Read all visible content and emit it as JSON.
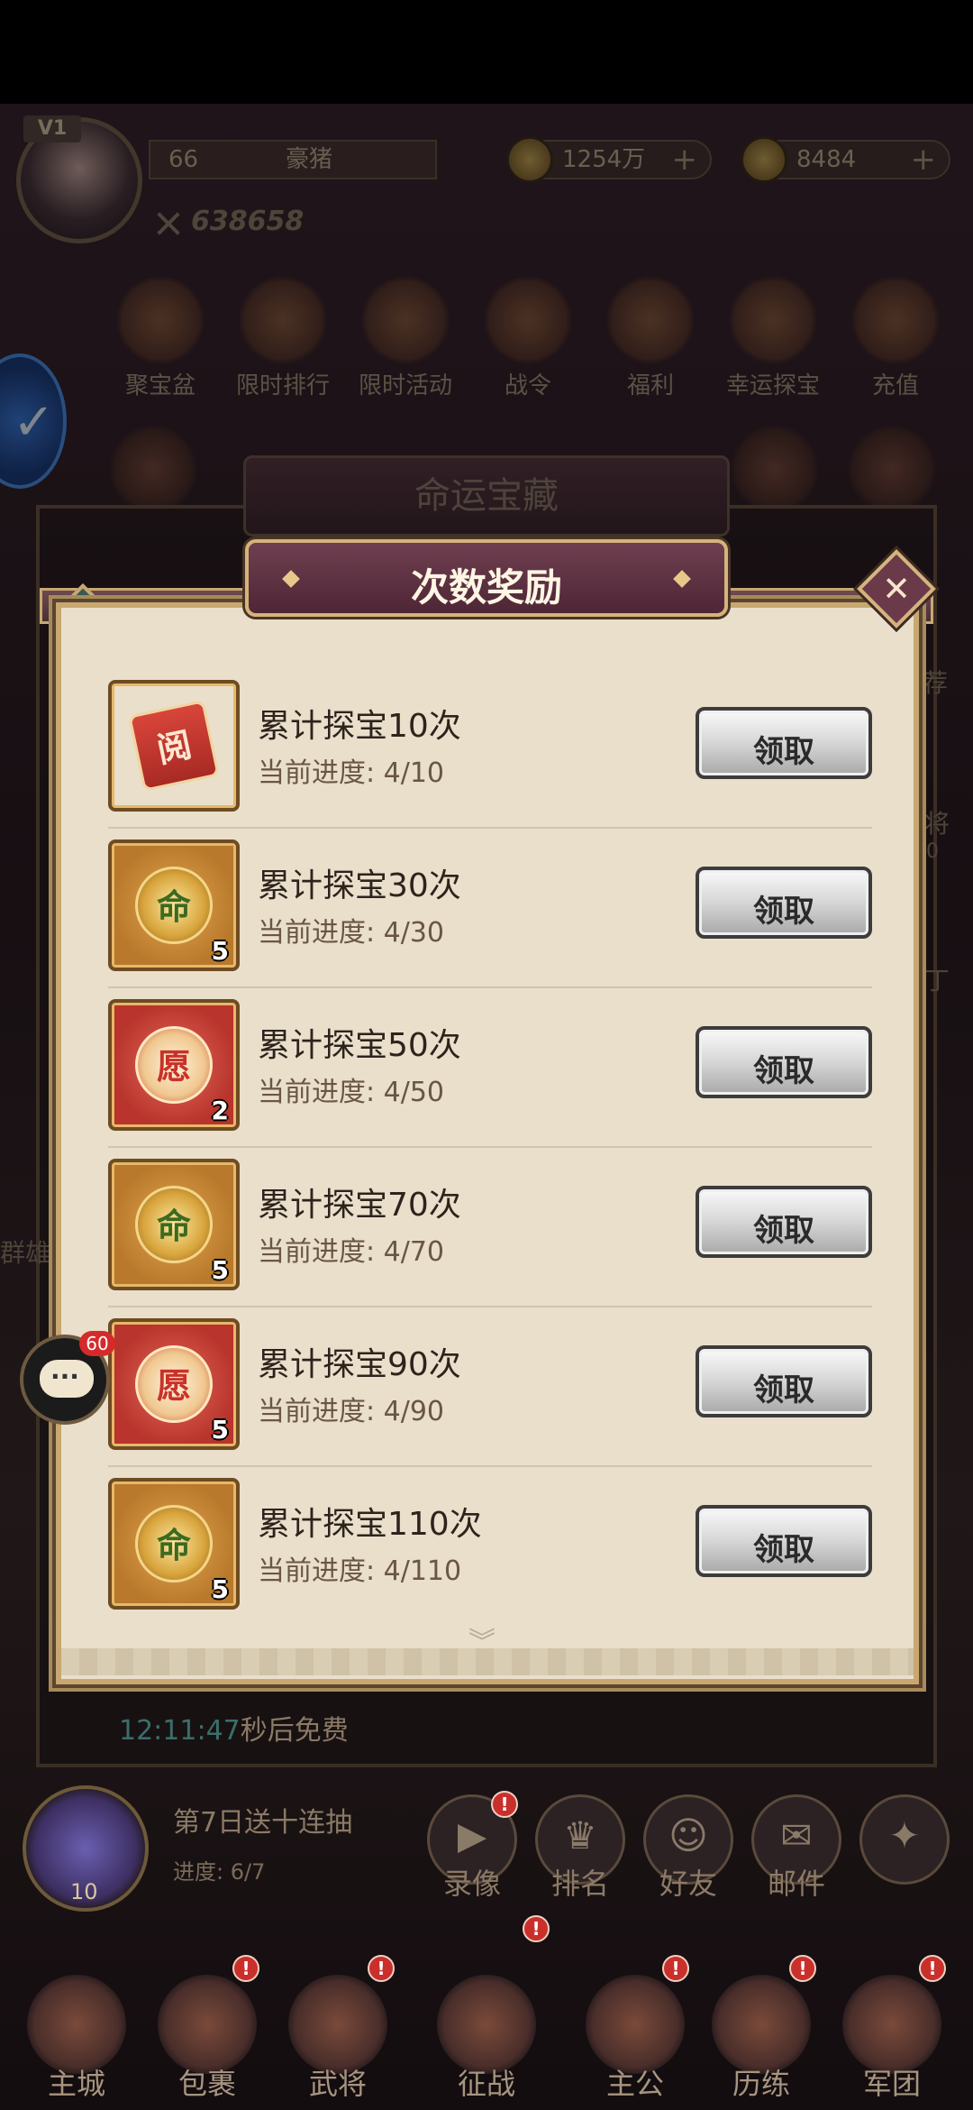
{
  "player": {
    "vip": "V1",
    "level": "66",
    "name": "豪猪",
    "power": "638658"
  },
  "currency": {
    "coins": "1254万",
    "ingots": "8484"
  },
  "top_menu": [
    {
      "label": "聚宝盆",
      "icon": "treasure-bowl-icon"
    },
    {
      "label": "限时排行",
      "icon": "trophy-icon"
    },
    {
      "label": "限时活动",
      "icon": "drum-icon"
    },
    {
      "label": "战令",
      "icon": "war-order-icon"
    },
    {
      "label": "福利",
      "icon": "chest-icon"
    },
    {
      "label": "幸运探宝",
      "icon": "lucky-wheel-icon"
    },
    {
      "label": "充值",
      "icon": "money-bag-icon"
    }
  ],
  "side_labels": {
    "right_1": "荐",
    "right_2": "将",
    "right_2b": "0",
    "right_3": "丁",
    "left_1": "群雄"
  },
  "chat": {
    "badge": "60"
  },
  "background_dialog": {
    "title": "命运宝藏"
  },
  "modal": {
    "title": "次数奖励",
    "close_icon": "close-icon",
    "rows": [
      {
        "title": "累计探宝10次",
        "progress": "当前进度: 4/10",
        "item_style": "scroll",
        "item_glyph": "阅",
        "count": "",
        "button": "领取"
      },
      {
        "title": "累计探宝30次",
        "progress": "当前进度: 4/30",
        "item_style": "gold",
        "item_glyph": "命",
        "count": "5",
        "button": "领取"
      },
      {
        "title": "累计探宝50次",
        "progress": "当前进度: 4/50",
        "item_style": "red",
        "item_glyph": "愿",
        "count": "2",
        "button": "领取"
      },
      {
        "title": "累计探宝70次",
        "progress": "当前进度: 4/70",
        "item_style": "gold",
        "item_glyph": "命",
        "count": "5",
        "button": "领取"
      },
      {
        "title": "累计探宝90次",
        "progress": "当前进度: 4/90",
        "item_style": "red",
        "item_glyph": "愿",
        "count": "5",
        "button": "领取"
      },
      {
        "title": "累计探宝110次",
        "progress": "当前进度: 4/110",
        "item_style": "gold",
        "item_glyph": "命",
        "count": "5",
        "button": "领取"
      }
    ]
  },
  "timer": {
    "time": "12:11:47",
    "suffix": "秒后免费"
  },
  "promo": {
    "title": "第7日送十连抽",
    "progress": "进度:  6/7",
    "count": "10"
  },
  "utility": [
    {
      "label": "录像",
      "icon": "video-icon",
      "glyph": "▶",
      "badge": "!"
    },
    {
      "label": "排名",
      "icon": "trophy-icon",
      "glyph": "♛",
      "badge": ""
    },
    {
      "label": "好友",
      "icon": "friends-icon",
      "glyph": "☺",
      "badge": ""
    },
    {
      "label": "邮件",
      "icon": "mail-icon",
      "glyph": "✉",
      "badge": ""
    },
    {
      "label": "",
      "icon": "compass-icon",
      "glyph": "✦",
      "badge": ""
    }
  ],
  "bottom_nav": [
    {
      "label": "主城",
      "icon": "city-icon",
      "badge": ""
    },
    {
      "label": "包裹",
      "icon": "bag-icon",
      "badge": "!"
    },
    {
      "label": "武将",
      "icon": "general-icon",
      "badge": "!"
    },
    {
      "label": "征战",
      "icon": "battle-icon",
      "badge": "!"
    },
    {
      "label": "主公",
      "icon": "lord-icon",
      "badge": "!"
    },
    {
      "label": "历练",
      "icon": "training-icon",
      "badge": "!"
    },
    {
      "label": "军团",
      "icon": "legion-icon",
      "badge": "!"
    }
  ]
}
